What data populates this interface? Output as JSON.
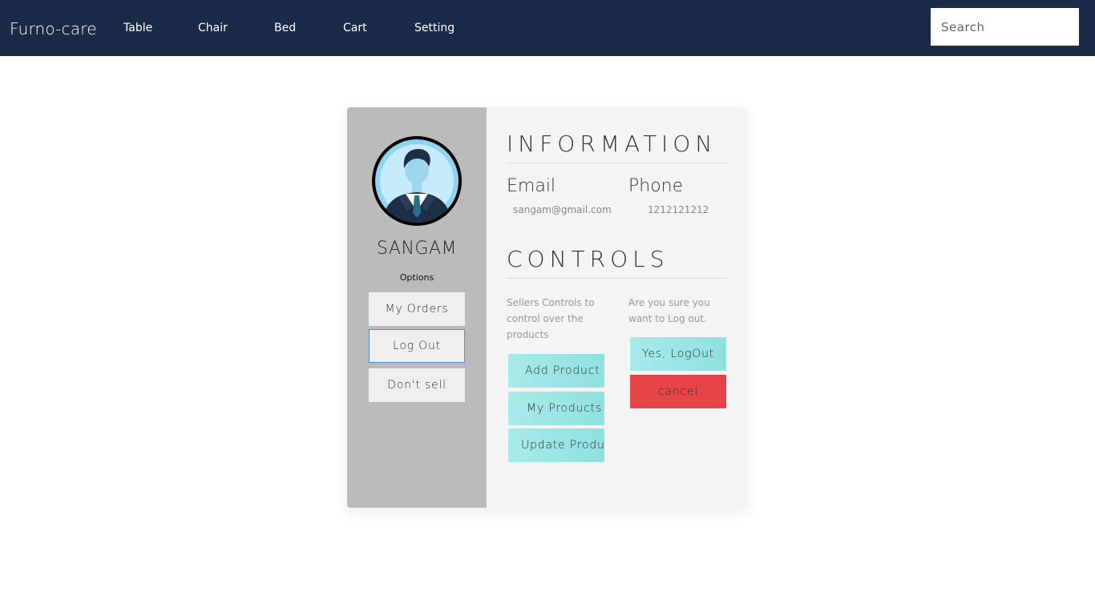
{
  "nav": {
    "brand": "Furno-care",
    "links": [
      "Table",
      "Chair",
      "Bed",
      "Cart",
      "Setting"
    ],
    "search_placeholder": "Search"
  },
  "profile": {
    "name": "SANGAM",
    "options_label": "Options",
    "buttons": [
      "My Orders",
      "Log Out",
      "Don't sell"
    ]
  },
  "information": {
    "title": "INFORMATION",
    "email_label": "Email",
    "email_value": "sangam@gmail.com",
    "phone_label": "Phone",
    "phone_value": "1212121212"
  },
  "controls": {
    "title": "CONTROLS",
    "seller_desc": "Sellers Controls to control over the products",
    "seller_buttons": [
      "Add Product",
      "My Products",
      "Update Product"
    ],
    "logout_desc": "Are you sure you want to Log out.",
    "confirm_label": "Yes, LogOut",
    "cancel_label": "cancel"
  },
  "colors": {
    "navbar": "#1b2a47",
    "sidebar": "#bbbbbb",
    "accent": "#8fe0e0",
    "danger": "#e64346"
  }
}
